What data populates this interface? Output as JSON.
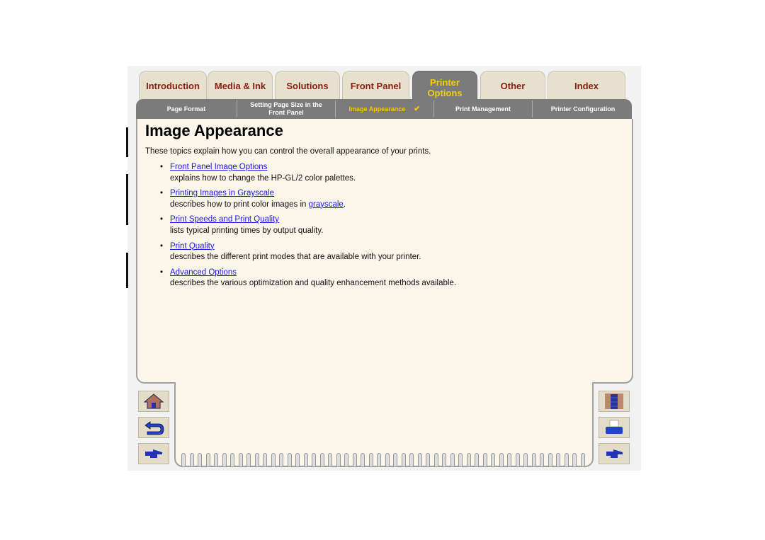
{
  "tabs": [
    {
      "label": "Introduction",
      "active": false
    },
    {
      "label": "Media & Ink",
      "active": false
    },
    {
      "label": "Solutions",
      "active": false
    },
    {
      "label": "Front Panel",
      "active": false
    },
    {
      "label_line1": "Printer",
      "label_line2": "Options",
      "active": true
    },
    {
      "label": "Other",
      "active": false
    },
    {
      "label": "Index",
      "active": false
    }
  ],
  "subnav": [
    {
      "label": "Page Format"
    },
    {
      "label_line1": "Setting Page Size in the",
      "label_line2": "Front Panel"
    },
    {
      "label": "Image Appearance",
      "active": true,
      "mark": "✔"
    },
    {
      "label": "Print Management"
    },
    {
      "label": "Printer Configuration"
    }
  ],
  "page": {
    "title": "Image Appearance",
    "intro": "These topics explain how you can control the overall appearance of your prints.",
    "items": [
      {
        "link": "Front Panel Image Options",
        "desc": "explains how to change the HP-GL/2 color palettes."
      },
      {
        "link": "Printing Images in Grayscale",
        "desc_pre": "describes how to print color images in ",
        "desc_link": "grayscale",
        "desc_post": "."
      },
      {
        "link": "Print Speeds and Print Quality",
        "desc": "lists typical printing times by output quality."
      },
      {
        "link": "Print Quality",
        "desc": "describes the different print modes that are available with your printer."
      },
      {
        "link": "Advanced Options",
        "desc": "describes the various optimization and quality enhancement methods available."
      }
    ]
  },
  "nav": {
    "left": [
      "home-icon",
      "back-arrow-icon",
      "next-pointer-icon"
    ],
    "right": [
      "exit-door-icon",
      "printer-icon",
      "pointer-hand-icon"
    ]
  },
  "colors": {
    "tab_text": "#8a1e10",
    "active_text": "#f5d000",
    "link": "#1a1ae6",
    "panel_bg": "#fcf6ea"
  }
}
